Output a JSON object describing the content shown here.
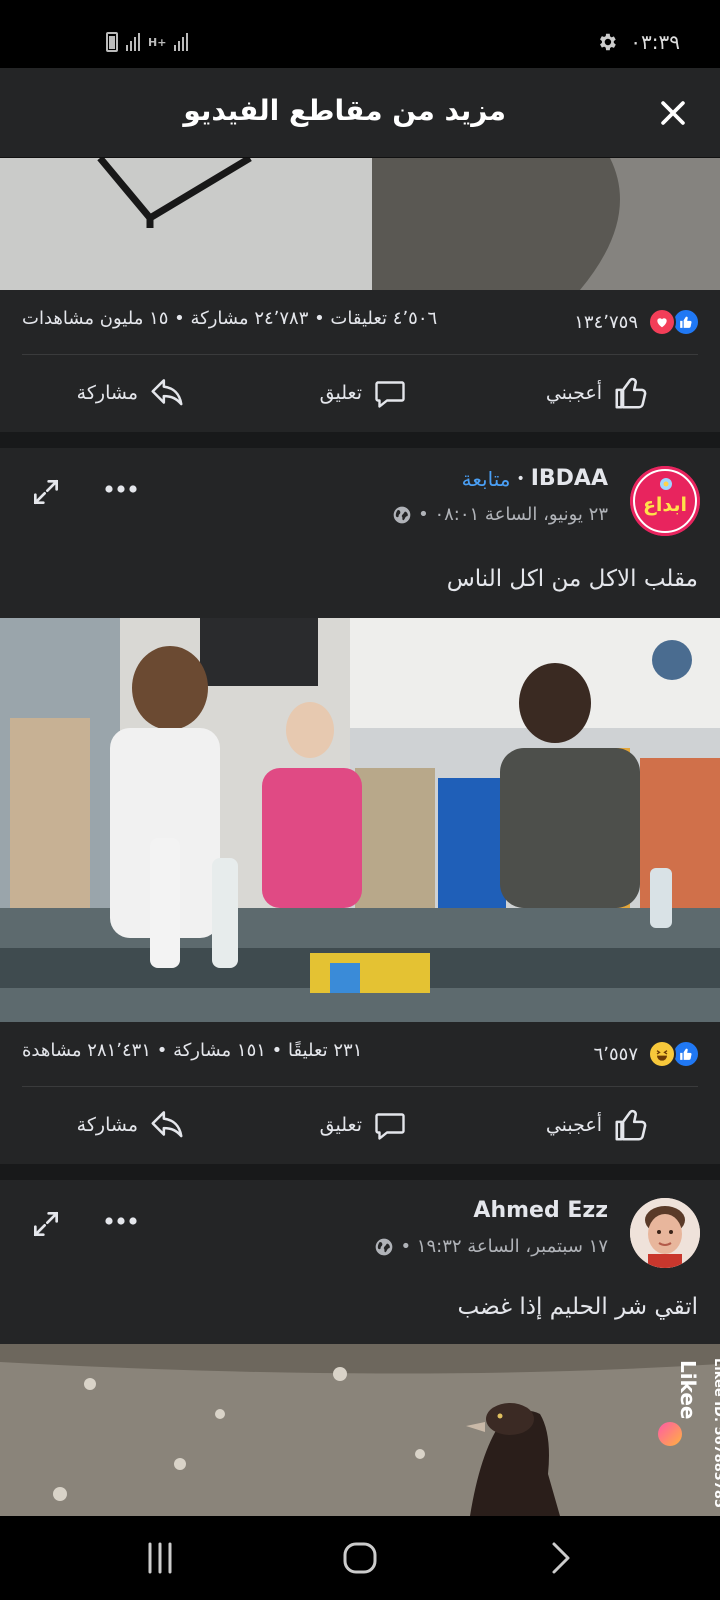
{
  "status_bar": {
    "time": "٠٣:٣٩",
    "network": "H+",
    "icons": [
      "battery-icon",
      "signal-icon",
      "signal-icon",
      "gear-icon"
    ]
  },
  "header": {
    "title": "مزيد من مقاطع الفيديو",
    "close_icon": "close-icon"
  },
  "posts": [
    {
      "reactions_count": "١٣٤٬٧٥٩",
      "reaction_icons": [
        "like-icon",
        "love-icon"
      ],
      "summary": "٤٬٥٠٦ تعليقات • ٢٤٬٧٨٣ مشاركة • ١٥ مليون مشاهدات",
      "actions": {
        "like": "أعجبني",
        "comment": "تعليق",
        "share": "مشاركة"
      }
    },
    {
      "author": "IBDAA",
      "follow": "متابعة",
      "separator": "•",
      "meta": "٢٣ يونيو، الساعة ٠٨:٠١ •",
      "caption": "مقلب الاكل من اكل الناس",
      "avatar_text": "ابداع",
      "reactions_count": "٦٬٥٥٧",
      "reaction_icons": [
        "like-icon",
        "haha-icon"
      ],
      "summary": "٢٣١ تعليقًا • ١٥١ مشاركة • ٢٨١٬٤٣١ مشاهدة",
      "actions": {
        "like": "أعجبني",
        "comment": "تعليق",
        "share": "مشاركة"
      }
    },
    {
      "author": "Ahmed Ezz",
      "meta": "١٧ سبتمبر، الساعة ١٩:٣٢ •",
      "caption": "اتقي شر الحليم إذا غضب",
      "watermark": "Likee",
      "watermark_id": "Likee ID: 567883785"
    }
  ],
  "colors": {
    "background": "#18191a",
    "card": "#242526",
    "accent_blue": "#4a9ff5",
    "like_blue": "#2078f4",
    "love_red": "#f33e58"
  },
  "navbar": {
    "icons": [
      "recents-icon",
      "home-icon",
      "back-icon"
    ]
  }
}
